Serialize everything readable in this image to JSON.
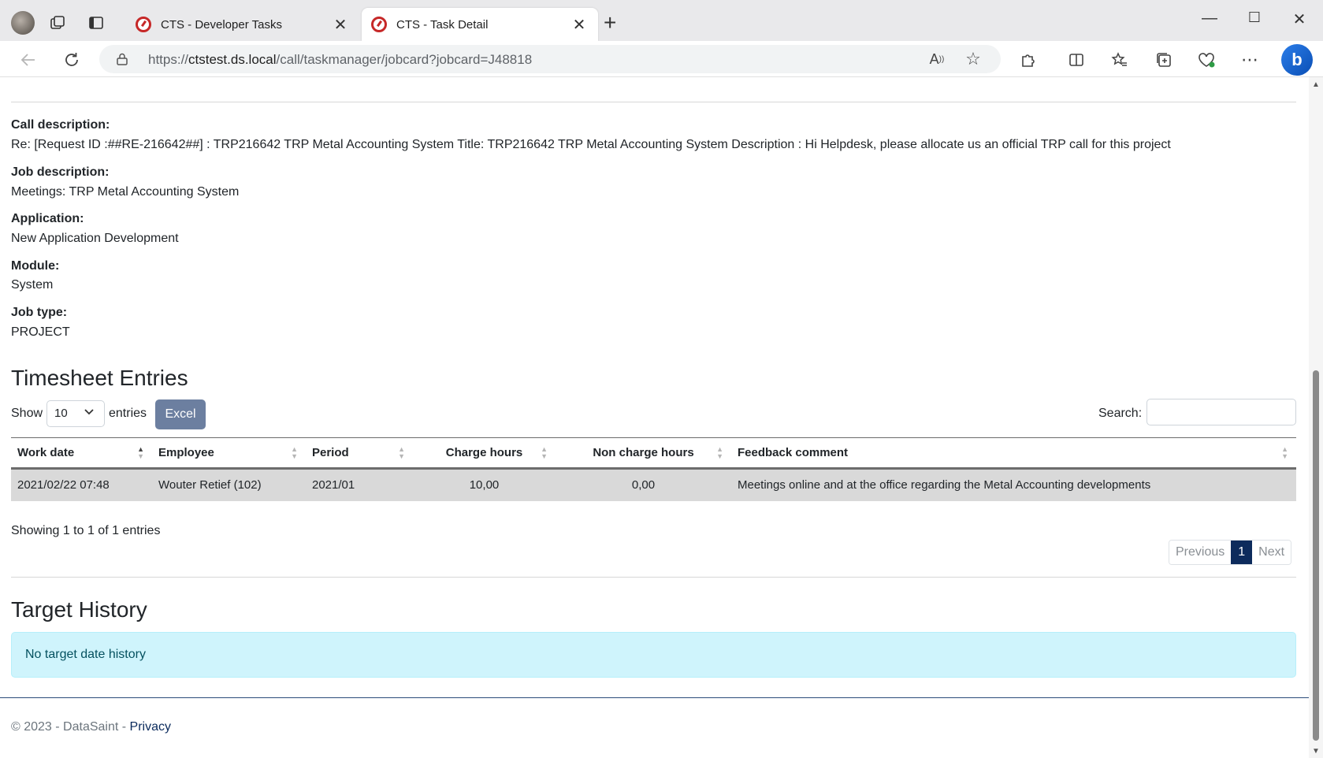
{
  "browser": {
    "tabs": [
      {
        "title": "CTS - Developer Tasks",
        "active": false
      },
      {
        "title": "CTS - Task Detail",
        "active": true
      }
    ],
    "url": {
      "scheme": "https://",
      "host": "ctstest.ds.local",
      "path": "/call/taskmanager/jobcard?jobcard=J48818"
    },
    "icons": {
      "profile": "avatar",
      "workspaces": "workspaces-icon",
      "tab_actions": "vertical-tabs-icon",
      "new_tab": "plus-icon",
      "back": "arrow-left-icon",
      "refresh": "refresh-icon",
      "read_aloud": "read-aloud-icon",
      "favorite": "star-icon",
      "extensions": "puzzle-icon",
      "split": "split-screen-icon",
      "favorites": "favorites-icon",
      "collections": "collections-icon",
      "performance": "heart-icon",
      "more": "ellipsis-icon",
      "copilot": "bing-icon"
    }
  },
  "details": {
    "call_description": {
      "label": "Call description:",
      "value": "Re: [Request ID :##RE-216642##] : TRP216642 TRP Metal Accounting System Title: TRP216642 TRP Metal Accounting System Description : Hi Helpdesk, please allocate us an official TRP call for this project"
    },
    "job_description": {
      "label": "Job description:",
      "value": "Meetings: TRP Metal Accounting System"
    },
    "application": {
      "label": "Application:",
      "value": "New Application Development"
    },
    "module": {
      "label": "Module:",
      "value": "System"
    },
    "job_type": {
      "label": "Job type:",
      "value": "PROJECT"
    }
  },
  "timesheet": {
    "title": "Timesheet Entries",
    "show_label": "Show",
    "page_length": "10",
    "entries_label": "entries",
    "excel_label": "Excel",
    "search_label": "Search:",
    "search_value": "",
    "columns": [
      "Work date",
      "Employee",
      "Period",
      "Charge hours",
      "Non charge hours",
      "Feedback comment"
    ],
    "rows": [
      [
        "2021/02/22 07:48",
        "Wouter Retief (102)",
        "2021/01",
        "10,00",
        "0,00",
        "Meetings online and at the office regarding the Metal Accounting developments"
      ]
    ],
    "info": "Showing 1 to 1 of 1 entries",
    "pagination": {
      "previous": "Previous",
      "current": "1",
      "next": "Next"
    }
  },
  "target_history": {
    "title": "Target History",
    "empty_message": "No target date history"
  },
  "footer": {
    "copyright": "© 2023 - DataSaint - ",
    "privacy": "Privacy"
  },
  "colors": {
    "excel_button": "#6c7fa0",
    "active_page": "#0d2b5c",
    "alert_bg": "#cff4fc",
    "row_bg": "#d9d9d9"
  }
}
